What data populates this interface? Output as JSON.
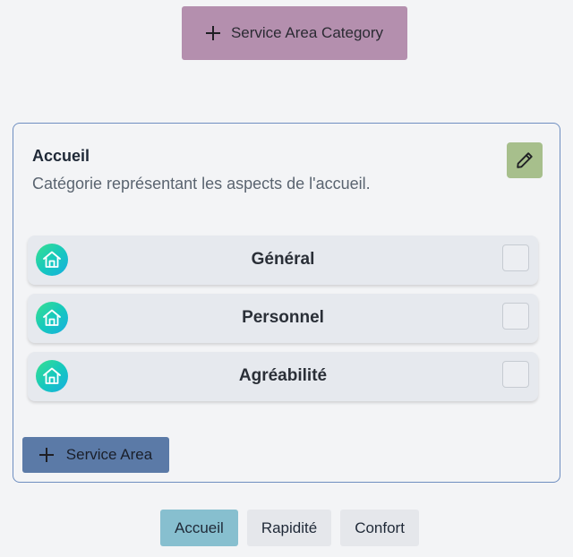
{
  "toolbar": {
    "add_category_label": "Service Area Category"
  },
  "category": {
    "title": "Accueil",
    "description": "Catégorie représentant les aspects de l'accueil.",
    "add_area_label": "Service Area",
    "areas": [
      {
        "label": "Général",
        "icon": "home-icon",
        "checked": false
      },
      {
        "label": "Personnel",
        "icon": "home-icon",
        "checked": false
      },
      {
        "label": "Agréabilité",
        "icon": "home-icon",
        "checked": false
      }
    ]
  },
  "tabs": [
    {
      "label": "Accueil",
      "active": true
    },
    {
      "label": "Rapidité",
      "active": false
    },
    {
      "label": "Confort",
      "active": false
    }
  ],
  "colors": {
    "category_button": "#b48fae",
    "edit_button": "#a7bf8c",
    "area_button": "#5b7aa7",
    "active_tab": "#87bfcf",
    "card_border": "#6e8ec0"
  }
}
